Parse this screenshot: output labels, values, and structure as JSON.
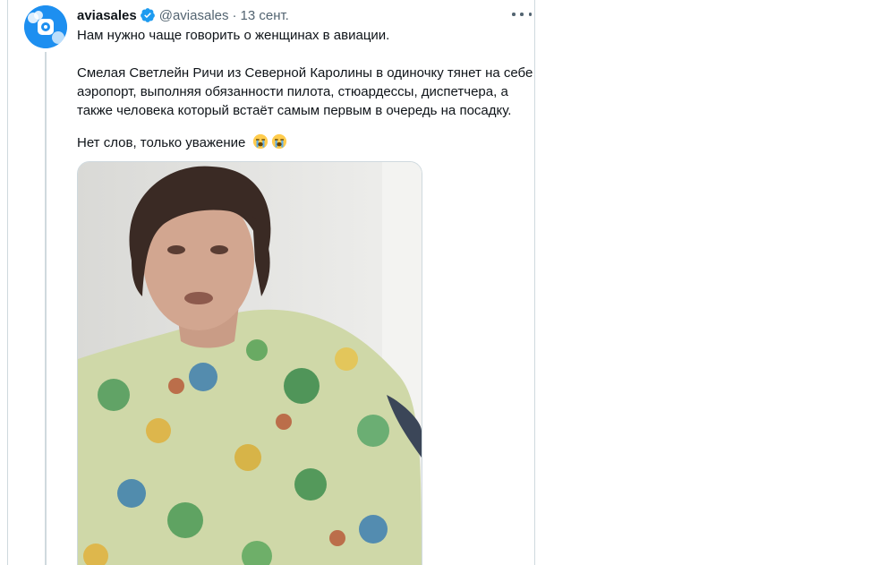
{
  "tweet": {
    "display_name": "aviasales",
    "handle": "@aviasales",
    "separator": "·",
    "date": "13 сент.",
    "line1": "Нам нужно чаще говорить о женщинах в авиации.",
    "para2_lines": [
      "Смелая Светлейн Ричи из Северной Каролины в одиночку тянет на себе",
      "аэропорт, выполняя обязанности пилота, стюардессы, диспетчера, а",
      "также человека который встаёт самым первым в очередь на посадку."
    ],
    "line3": "Нет слов, только уважение"
  },
  "icons": {
    "avatar": "aviasales-logo-avatar",
    "verified": "verified-badge-icon",
    "more": "more-options-icon",
    "emoji": "loudly-crying-face-emoji"
  },
  "colors": {
    "verified": "#1d9bf0",
    "avatar_bg": "#1d8ff0",
    "secondary_text": "#536471",
    "border": "#cfd9de"
  }
}
